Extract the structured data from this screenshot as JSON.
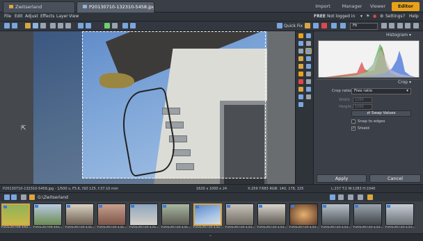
{
  "tabs": [
    {
      "label": "Zwitserland"
    },
    {
      "label": "P20130710-132310-5458.jpg"
    }
  ],
  "modes": [
    "Import",
    "Manager",
    "Viewer",
    "Editor"
  ],
  "active_mode": "Editor",
  "menu": [
    "File",
    "Edit",
    "Adjust",
    "Effects",
    "Layer",
    "View"
  ],
  "menu_right": {
    "free": "FREE",
    "login": "Not logged in",
    "settings": "Settings",
    "help": "Help"
  },
  "toolbar": {
    "quick_fix": "Quick Fix",
    "zoom_mode": "Fit"
  },
  "panel": {
    "histogram_title": "Histogram",
    "crop_title": "Crop",
    "crop_ratio_label": "Crop ratios",
    "crop_ratio_value": "Free ratio",
    "width_label": "Width",
    "width_value": "1200",
    "height_label": "Height",
    "height_value": "1000",
    "swap_values": "Swap Values",
    "snap_label": "Snap to edges",
    "snap_checked": false,
    "shield_label": "Shield",
    "shield_checked": true,
    "apply": "Apply",
    "cancel": "Cancel"
  },
  "status": {
    "file_info": "P20130710-132310-5458.jpg - 1/500 s, F5.6, ISO 125, f:37.10 mm",
    "dimensions": "1620 x 1000 x 24",
    "pixel_info": "X:259 Y:683 RGB: 140, 178, 225",
    "crop_info": "L:237 T:2 W:1283 H:1040"
  },
  "filmstrip": {
    "folder": "G:\\Zwitserland",
    "thumbs": [
      {
        "caption": "P20130709-160..."
      },
      {
        "caption": "P20130709-161..."
      },
      {
        "caption": "P20130710-131..."
      },
      {
        "caption": "P20130710-131..."
      },
      {
        "caption": "P20130710-131..."
      },
      {
        "caption": "P20130710-131..."
      },
      {
        "caption": "P20130710-132..."
      },
      {
        "caption": "P20130710-133..."
      },
      {
        "caption": "P20130710-133..."
      },
      {
        "caption": "P20130710-133..."
      },
      {
        "caption": "P20130710-133..."
      },
      {
        "caption": "P20130710-133..."
      },
      {
        "caption": "P20130710-133..."
      }
    ]
  },
  "colors": {
    "accent": "#e8a21a",
    "selection": "#d9a640"
  }
}
